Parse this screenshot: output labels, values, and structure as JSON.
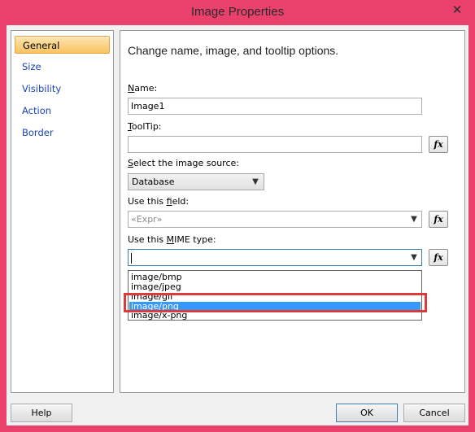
{
  "window": {
    "title": "Image Properties",
    "close_glyph": "✕"
  },
  "nav": {
    "items": [
      {
        "label": "General",
        "selected": true
      },
      {
        "label": "Size"
      },
      {
        "label": "Visibility"
      },
      {
        "label": "Action"
      },
      {
        "label": "Border"
      }
    ]
  },
  "panel": {
    "heading": "Change name, image, and tooltip options.",
    "name": {
      "label_first": "N",
      "label_rest": "ame:",
      "value": "Image1"
    },
    "tooltip": {
      "label_first": "T",
      "label_rest": "oolTip:",
      "value": ""
    },
    "source": {
      "label_first": "S",
      "label_rest": "elect the image source:",
      "value": "Database"
    },
    "field": {
      "label_pre": "Use this ",
      "label_key": "f",
      "label_post": "ield:",
      "value": "«Expr»"
    },
    "mime": {
      "label_pre": "Use this ",
      "label_key": "M",
      "label_post": "IME type:",
      "value": ""
    },
    "fx_label": "fx",
    "mime_options": [
      "image/bmp",
      "image/jpeg",
      "image/gif",
      "image/png",
      "image/x-png"
    ],
    "highlighted_option": "image/png"
  },
  "buttons": {
    "help": "Help",
    "ok": "OK",
    "cancel": "Cancel"
  },
  "colors": {
    "window_frame": "#e9416c",
    "nav_link": "#1a45b8",
    "highlight": "#3399ff",
    "callout": "#de3a3a"
  }
}
